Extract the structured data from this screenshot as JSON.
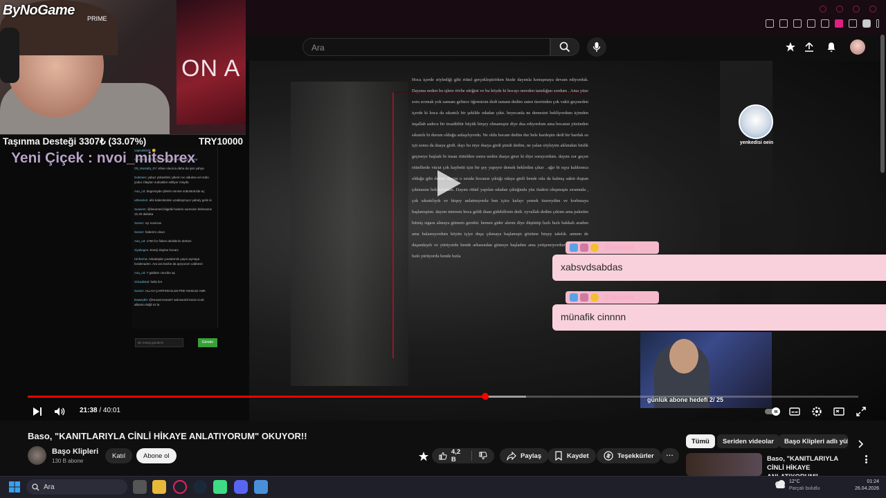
{
  "browser": {
    "tab_icons": [
      "pin-icon",
      "screen-icon",
      "shield-icon",
      "send-icon",
      "heart-icon",
      "extension-icon",
      "puzzle-icon",
      "profile-icon",
      "menu-icon"
    ]
  },
  "header": {
    "search_placeholder": "Ara",
    "icons": [
      "search-icon",
      "mic-icon",
      "create-icon",
      "upload-icon",
      "bell-icon",
      "avatar"
    ]
  },
  "stream": {
    "brand": "ByNoGame",
    "brand_sub": "PRIME",
    "poster_text": "ON A",
    "donation_label": "Taşınma Desteği 3307₺ (33.07%)",
    "donation_goal": "TRY10000",
    "flower_line": "Yeni Çiçek : nvoi_mitsbrex",
    "cat_name": "yenkedisi oein",
    "cam2_text": "günlük abone hedefi 2/ 25",
    "story_text": "Hoca içerde söylediği gibi ritüel gerçekleştirirken bizde dayımla konuşmaya devam ediyorduk. Dayıma neden bu işlere tövbe ettiğini ve bu köyde ki hocayı nereden tanıdığını sordum . Ama yüze soru sormak yok zamanı gelince öğrenirsin dedi tamam dedim zaten üzerinden çok vakit geçmeden içerde ki hoca da sıkıntılı bir şekilde odadan çıktı. heyecanla ne demesini bekliyordum içimden inşallah sadece bir tesadüftür büyük birşey olmamıştır diye dua ediyordum ama hocanın yüzünden sıkıntılı bi durum olduğu anlaşılıyordu. Ne oldu hocam dedim dur hele kardeşim dedi bir bardak su içti sonra da duaya girdi. dayı bu niye duaya girdi şimdi dedim, ne yalan söyleyim aklımdan binlik geçmeye başladı bi insan ritüelden sonra neden duaya girer ki diye soruyordum. dayım zor geçen ritüellerde vücut çok kaybetti için bir şey yapıyor demek bekledim çıkar . ağır bi eşya kaldırınca olduğu gibi dedim dayım o sırada hocanın çıktığı odaya girdi bende oda da kalmış sakin duştan çıkmasını bekliyordum. Dayım ritüel yapılan odadan çıktığında yüz ifadesi oluşmuştu sıranında , çok sıkıntılıydı ve birşey anlatmıyordu ben içice kafayı yemek üzereydim ve korkmaya başlamıştım. dayım intersen hoca geldi duan gidebilirsin dedi. eyvallah dedim çıktım ama paketim bitmiş sigara almaya gitmem gerekti. hemen gider alırım diye düşünüp hızlı hızlı bakkalı aradım ama bulamıyordum köyün içiye duşa çıkmaya başlamıştı gözüme birşey takıldı. annem de duşandaydı ve yürüyordu bende arkasından gitmeye başladım ama yetişemiyordum annem çok hızlı yürüyordu bende hızla",
    "chat_lines": [
      {
        "user": "Nexbu_Kadi",
        "text": "bu hala sigara düşünüyor şafak aç"
      },
      {
        "user": "karadeniz59",
        "text": "👍"
      },
      {
        "user": "Satan_Badi",
        "text": "okn oyle yapilmaz duvarlara uymasiz"
      },
      {
        "user": "capsula026",
        "text": "😊"
      },
      {
        "user": "Guidembol",
        "text": "bağımlı adam olm eli ayağı titriyor"
      },
      {
        "user": "Oli_Mostafa_0Y",
        "text": "sihan oluorca daha da iyisi yahya"
      },
      {
        "user": "Gokmen",
        "text": "yabuz yükseltiris çitlerin ne olduksa vel sübü yüdur zilayları subsaklar ediliyor müydü"
      },
      {
        "user": "Asa_o3",
        "text": "degersiyde çitlerin ünnine sübüstürizde aç"
      },
      {
        "user": "uthsevlen",
        "text": "afis kalemlerden uzaklaşmıyor yabuly gelin le"
      },
      {
        "user": "Suavem",
        "text": "@leeomed bilgelik hoskris suresinin bitimesine 15 20 dahaka"
      },
      {
        "user": "Sumer",
        "text": "sçi sculcras"
      },
      {
        "user": "Sumer",
        "text": "haberim olsun"
      },
      {
        "user": "Asa_o3",
        "text": "1760 for fiskes dediskrim derken"
      },
      {
        "user": "clyakeges",
        "text": "Enerji slaylan hocam"
      },
      {
        "user": "Hinforma",
        "text": "Arkadaşlar youtube'de yayın açmaya bırakmadım. Ara ara büzbe da apryorum cabbesi!"
      },
      {
        "user": "Asa_o3",
        "text": "7 güldüm cüncike aş"
      },
      {
        "user": "cblcadistal",
        "text": "hello lire"
      },
      {
        "user": "Sumer",
        "text": "ALLAH ÇARPSIN ELEKTRIK KESILDI AMK"
      },
      {
        "user": "Daweyb0",
        "text": "@HusuKAsma07 astroworld travis scott albümü değil mi la"
      }
    ],
    "chat_input_placeholder": "Bir mesaj gönderin",
    "chat_send_label": "Gönder",
    "alerts": [
      {
        "who": "Elfaswate",
        "text": "xabsvdsabdas"
      },
      {
        "who": "Elfaswate",
        "text": "münafik cinnnn"
      }
    ]
  },
  "player": {
    "time_current": "21:38",
    "time_total": "40:01",
    "time_display": "21:38 / 40:01",
    "progress_played": 0.551,
    "progress_buffered": 0.6,
    "icons": [
      "play-icon",
      "volume-icon",
      "autoplay-toggle",
      "subtitles-icon",
      "settings-icon",
      "miniplayer-icon",
      "fullscreen-icon"
    ]
  },
  "video_info": {
    "title": "Baso, \"KANITLARIYLA CİNLİ HİKAYE ANLATIYORUM\" OKUYOR!!",
    "channel_name": "Başo Klipleri",
    "subscribers": "130 B abone",
    "join_label": "Katıl",
    "subscribe_label": "Abone ol",
    "likes": "4,2 B",
    "share_label": "Paylaş",
    "save_label": "Kaydet",
    "thanks_label": "Teşekkürler",
    "more_label": "..."
  },
  "sidebar": {
    "chips": [
      "Tümü",
      "Seriden videolar",
      "Başo Klipleri adlı yükle"
    ],
    "rec_title": "Baso, \"KANITLARIYLA CİNLİ HİKAYE ANLATIYORUM\" ..."
  },
  "taskbar": {
    "search_label": "Ara",
    "weather_temp": "12°C",
    "weather_desc": "Parçalı bulutlu",
    "time": "01:24",
    "date": "26.04.2026"
  },
  "colors": {
    "accent_red": "#ff0000",
    "alert_pink": "#f9d1dc",
    "background": "#0f0f0f"
  }
}
